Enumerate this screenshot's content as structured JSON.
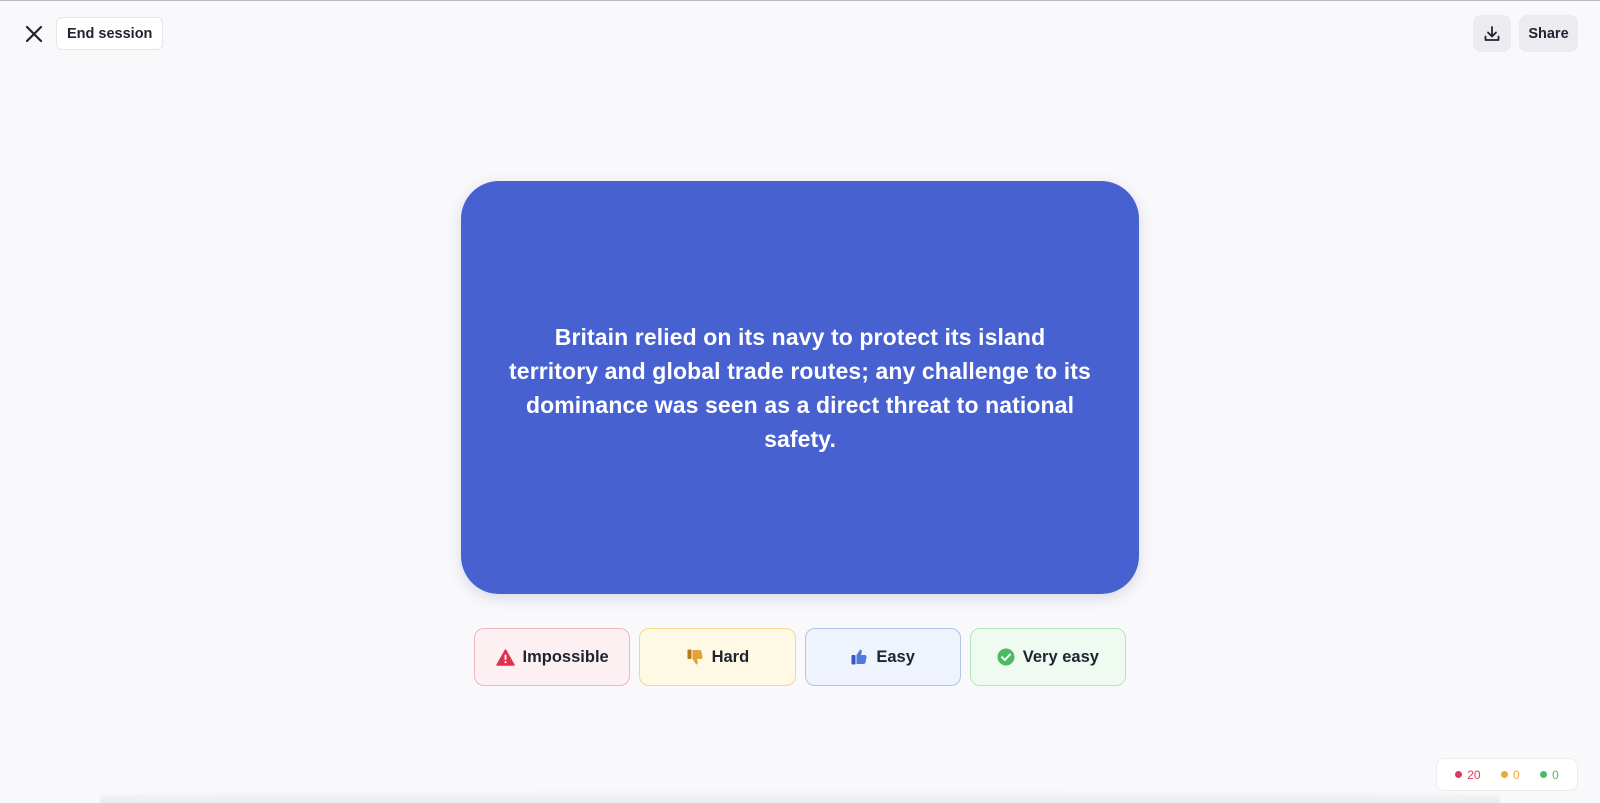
{
  "topbar": {
    "close_icon": "close-icon",
    "end_session_label": "End session",
    "download_icon": "download-icon",
    "share_label": "Share"
  },
  "card": {
    "text": "Britain relied on its navy to protect its island territory and global trade routes; any challenge to its dominance was seen as a direct threat to national safety.",
    "color": "#4761d1"
  },
  "ratings": [
    {
      "label": "Impossible",
      "icon": "warning-icon",
      "color": "#e0314f"
    },
    {
      "label": "Hard",
      "icon": "thumbs-down-icon",
      "color": "#d99a2b"
    },
    {
      "label": "Easy",
      "icon": "thumbs-up-icon",
      "color": "#4a6fd8"
    },
    {
      "label": "Very easy",
      "icon": "check-circle-icon",
      "color": "#4cb963"
    }
  ],
  "counters": [
    {
      "value": "20",
      "color": "#d93a5c"
    },
    {
      "value": "0",
      "color": "#f0a53a"
    },
    {
      "value": "0",
      "color": "#4cb963"
    }
  ]
}
